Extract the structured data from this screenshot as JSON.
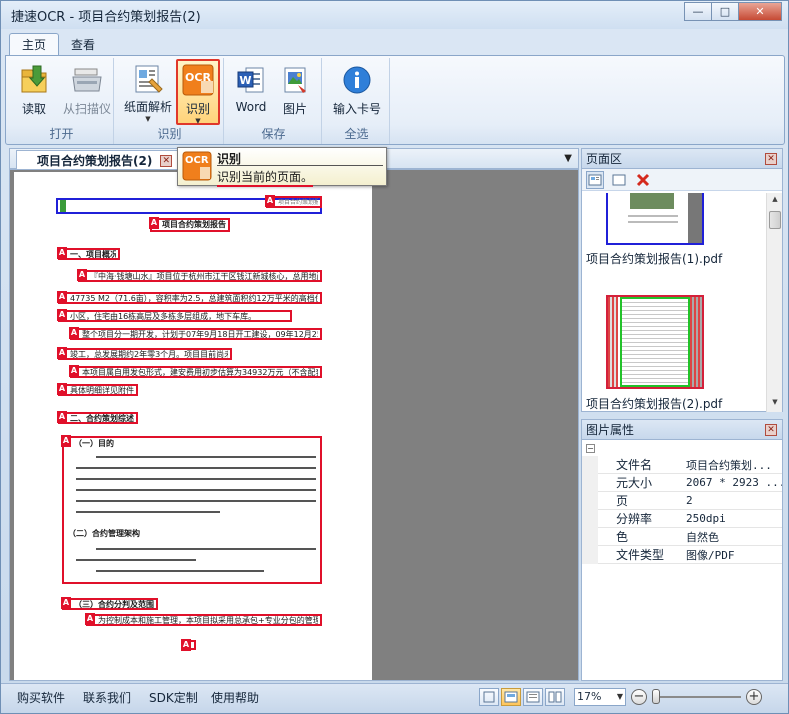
{
  "window": {
    "title": "捷速OCR - 项目合约策划报告(2)",
    "controls": {
      "minimize": "—",
      "maximize": "□",
      "close": "✕"
    }
  },
  "ribbon": {
    "tabs": [
      {
        "label": "主页",
        "active": true
      },
      {
        "label": "查看",
        "active": false
      }
    ],
    "groups": {
      "open": {
        "label": "打开",
        "read": "读取",
        "scan": "从扫描仪"
      },
      "recognize": {
        "label": "识别",
        "layout": "纸面解析",
        "ocr": "识别",
        "ocr_badge": "OCR"
      },
      "save": {
        "label": "保存",
        "word": "Word",
        "image": "图片"
      },
      "select_all": {
        "label": "全选",
        "serial": "输入卡号"
      }
    }
  },
  "document": {
    "tab_title": "项目合约策划报告(2)",
    "tab_close": "✕",
    "list_arrow": "▼",
    "region_marker": "A",
    "regions": [
      "项目合约策划报告",
      "一、项目概况",
      "『中海·钱塘山水』项目位于杭州市江干区钱江新城核心，总用地面积为",
      "47735 M2（71.6亩），容积率为2.5，总建筑面积约12万平米的高档住宅",
      "小区，住宅由16栋高层及多栋多层组成，地下车库。",
      "整个项目分一期开发，计划于07年9月18日开工建设，09年12月25日",
      "竣工，总发展期约2年零3个月。项目目前尚未开工。",
      "本项目属自用发包形式，建安费用初步估算为34932万元（不含配套）",
      "具体明细详见附件一",
      "二、合约策划综述",
      "（一）目的",
      "（二）合约管理架构",
      "（三）合约分判及范围",
      "为控制成本和施工管理，本项目拟采用总承包+专业分包的管理模式。"
    ],
    "header_small_text": "项目合约策划报告"
  },
  "tooltip": {
    "title": "识别",
    "description": "识别当前的页面。",
    "icon_badge": "OCR"
  },
  "page_panel": {
    "title": "页面区",
    "close": "✕",
    "thumbnails": [
      {
        "label": "项目合约策划报告(1).pdf"
      },
      {
        "label": "项目合约策划报告(2).pdf"
      }
    ],
    "scroll_up": "▲",
    "scroll_down": "▼"
  },
  "props_panel": {
    "title": "图片属性",
    "close": "✕",
    "toggle": "−",
    "rows": [
      {
        "key": "文件名",
        "value": "项目合约策划..."
      },
      {
        "key": "元大小",
        "value": "2067 * 2923 ..."
      },
      {
        "key": "页",
        "value": "2"
      },
      {
        "key": "分辨率",
        "value": "250dpi"
      },
      {
        "key": "色",
        "value": "自然色"
      },
      {
        "key": "文件类型",
        "value": "图像/PDF"
      }
    ]
  },
  "statusbar": {
    "links": [
      "购买软件",
      "联系我们",
      "SDK定制",
      "使用帮助"
    ],
    "zoom": "17%",
    "zoom_arrow": "▼",
    "zoom_out": "−",
    "zoom_in": "+",
    "zoom_fraction": 0.03
  },
  "colors": {
    "region_red": "#e0102a",
    "region_blue": "#2020d8",
    "ribbon_highlight": "#ffd37a"
  }
}
